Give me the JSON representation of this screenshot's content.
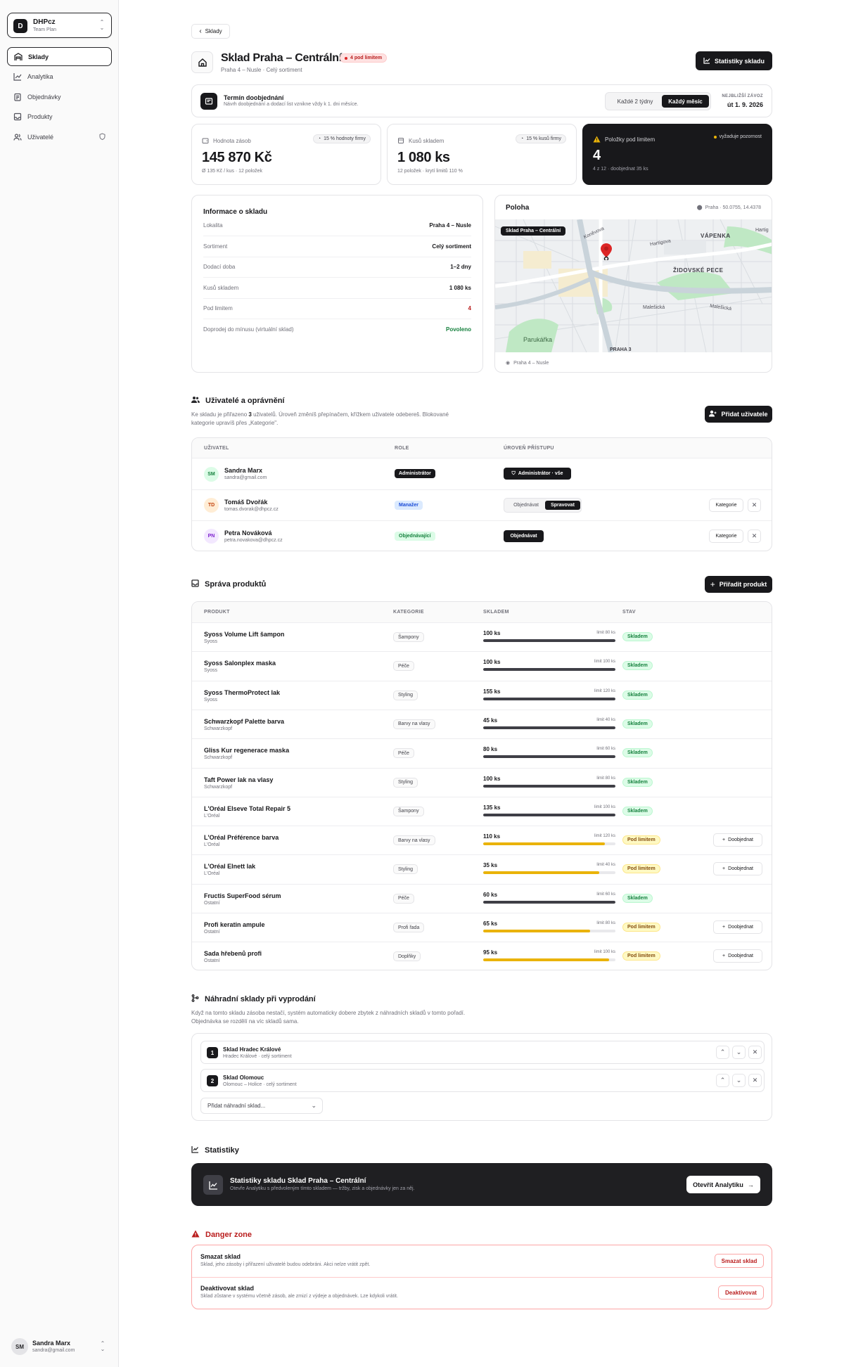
{
  "sidebar": {
    "team": {
      "initial": "D",
      "name": "DHPcz",
      "plan": "Team Plan"
    },
    "items": [
      {
        "label": "Sklady",
        "icon": "warehouse-icon",
        "active": true
      },
      {
        "label": "Analytika",
        "icon": "chart-line-icon"
      },
      {
        "label": "Objednávky",
        "icon": "clipboard-icon"
      },
      {
        "label": "Produkty",
        "icon": "inbox-icon"
      },
      {
        "label": "Uživatelé",
        "icon": "users-icon"
      }
    ],
    "user": {
      "initials": "SM",
      "name": "Sandra Marx",
      "email": "sandra@gmail.com"
    }
  },
  "header": {
    "back_label": "Sklady",
    "title": "Sklad Praha – Centrální",
    "badge": "4 pod limitem",
    "subtitle": "Praha 4 – Nusle · Celý sortiment",
    "stats_button": "Statistiky skladu"
  },
  "reorder": {
    "title": "Termín doobjednání",
    "desc": "Návrh doobjednání a dodací list vznikne vždy k 1. dni měsíce.",
    "options": [
      "Každé 2 týdny",
      "Každý měsíc"
    ],
    "next_label": "NEJBLIŽŠÍ ZÁVOZ",
    "next_value": "út 1. 9. 2026"
  },
  "kpis": [
    {
      "label": "Hodnota zásob",
      "badge": "15 % hodnoty firmy",
      "value": "145 870 Kč",
      "sub": "Ø 135 Kč / kus · 12 položek"
    },
    {
      "label": "Kusů skladem",
      "badge": "15 % kusů firmy",
      "value": "1 080 ks",
      "sub": "12 položek · krytí limitů 110 %"
    },
    {
      "label": "Položky pod limitem",
      "badge": "vyžaduje pozornost",
      "value": "4",
      "sub": "4 z 12 · doobjednat 35 ks"
    }
  ],
  "info": {
    "title": "Informace o skladu",
    "rows": [
      {
        "k": "Lokalita",
        "v": "Praha 4 – Nusle"
      },
      {
        "k": "Sortiment",
        "v": "Celý sortiment"
      },
      {
        "k": "Dodací doba",
        "v": "1–2 dny"
      },
      {
        "k": "Kusů skladem",
        "v": "1 080 ks"
      },
      {
        "k": "Pod limitem",
        "v": "4"
      },
      {
        "k": "Doprodej do mínusu (virtuální sklad)",
        "v": "Povoleno"
      }
    ]
  },
  "map": {
    "title": "Poloha",
    "coords": "Praha · 50.0755, 14.4378",
    "pin_label": "Sklad Praha – Centrální",
    "footer": "Praha 4 – Nusle",
    "labels": [
      "VÁPENKA",
      "ŽIDOVSKÉ PECE",
      "Hartigova",
      "Koněvova",
      "Malešická",
      "Malešická",
      "Parukářka",
      "PRAHA 3",
      "Hartig"
    ]
  },
  "users": {
    "title": "Uživatelé a oprávnění",
    "desc_a": "Ke skladu je přiřazeno ",
    "count": "3",
    "desc_b": " uživatelů. Úroveň změníš přepínačem, křížkem uživatele odebereš. Blokované kategorie upravíš přes „Kategorie\".",
    "add_button": "Přidat uživatele",
    "headers": [
      "UŽIVATEL",
      "ROLE",
      "ÚROVEŇ PŘÍSTUPU"
    ],
    "rows": [
      {
        "initials": "SM",
        "name": "Sandra Marx",
        "email": "sandra@gmail.com",
        "role": "Administrátor",
        "access": "Administrátor · vše"
      },
      {
        "initials": "TD",
        "name": "Tomáš Dvořák",
        "email": "tomas.dvorak@dhpcz.cz",
        "role": "Manažer",
        "access_options": [
          "Objednávat",
          "Spravovat"
        ],
        "cat": "Kategorie"
      },
      {
        "initials": "PN",
        "name": "Petra Nováková",
        "email": "petra.novakova@dhpcz.cz",
        "role": "Objednávající",
        "access_options": [
          "Objednávat"
        ],
        "cat": "Kategorie"
      }
    ]
  },
  "products": {
    "title": "Správa produktů",
    "add_button": "Přiřadit produkt",
    "headers": [
      "PRODUKT",
      "KATEGORIE",
      "SKLADEM",
      "STAV"
    ],
    "reorder_label": "Doobjednat",
    "rows": [
      {
        "name": "Syoss Volume Lift šampon",
        "brand": "Syoss",
        "cat": "Šampony",
        "stock": "100 ks",
        "limit": "limit 80 ks",
        "fill": 1.0,
        "status": "Skladem"
      },
      {
        "name": "Syoss Salonplex maska",
        "brand": "Syoss",
        "cat": "Péče",
        "stock": "100 ks",
        "limit": "limit 100 ks",
        "fill": 1.0,
        "status": "Skladem"
      },
      {
        "name": "Syoss ThermoProtect lak",
        "brand": "Syoss",
        "cat": "Styling",
        "stock": "155 ks",
        "limit": "limit 120 ks",
        "fill": 1.0,
        "status": "Skladem"
      },
      {
        "name": "Schwarzkopf Palette barva",
        "brand": "Schwarzkopf",
        "cat": "Barvy na vlasy",
        "stock": "45 ks",
        "limit": "limit 40 ks",
        "fill": 1.0,
        "status": "Skladem"
      },
      {
        "name": "Gliss Kur regenerace maska",
        "brand": "Schwarzkopf",
        "cat": "Péče",
        "stock": "80 ks",
        "limit": "limit 60 ks",
        "fill": 1.0,
        "status": "Skladem"
      },
      {
        "name": "Taft Power lak na vlasy",
        "brand": "Schwarzkopf",
        "cat": "Styling",
        "stock": "100 ks",
        "limit": "limit 80 ks",
        "fill": 1.0,
        "status": "Skladem"
      },
      {
        "name": "L'Oréal Elseve Total Repair 5",
        "brand": "L'Oréal",
        "cat": "Šampony",
        "stock": "135 ks",
        "limit": "limit 100 ks",
        "fill": 1.0,
        "status": "Skladem"
      },
      {
        "name": "L'Oréal Préférence barva",
        "brand": "L'Oréal",
        "cat": "Barvy na vlasy",
        "stock": "110 ks",
        "limit": "limit 120 ks",
        "fill": 0.92,
        "status": "Pod limitem"
      },
      {
        "name": "L'Oréal Elnett lak",
        "brand": "L'Oréal",
        "cat": "Styling",
        "stock": "35 ks",
        "limit": "limit 40 ks",
        "fill": 0.88,
        "status": "Pod limitem"
      },
      {
        "name": "Fructis SuperFood sérum",
        "brand": "Ostatní",
        "cat": "Péče",
        "stock": "60 ks",
        "limit": "limit 60 ks",
        "fill": 1.0,
        "status": "Skladem"
      },
      {
        "name": "Profi keratin ampule",
        "brand": "Ostatní",
        "cat": "Profi řada",
        "stock": "65 ks",
        "limit": "limit 80 ks",
        "fill": 0.81,
        "status": "Pod limitem"
      },
      {
        "name": "Sada hřebenů profi",
        "brand": "Ostatní",
        "cat": "Doplňky",
        "stock": "95 ks",
        "limit": "limit 100 ks",
        "fill": 0.95,
        "status": "Pod limitem"
      }
    ]
  },
  "fallback": {
    "title": "Náhradní sklady při vyprodání",
    "desc": "Když na tomto skladu zásoba nestačí, systém automaticky dobere zbytek z náhradních skladů v tomto pořadí. Objednávka se rozdělí na víc skladů sama.",
    "items": [
      {
        "n": "1",
        "name": "Sklad Hradec Králové",
        "sub": "Hradec Králové · celý sortiment"
      },
      {
        "n": "2",
        "name": "Sklad Olomouc",
        "sub": "Olomouc – Holice · celý sortiment"
      }
    ],
    "add_placeholder": "Přidat náhradní sklad..."
  },
  "stats": {
    "section_title": "Statistiky",
    "title": "Statistiky skladu Sklad Praha – Centrální",
    "desc": "Otevře Analytiku s předvoleným tímto skladem — tržby, zisk a objednávky jen za něj.",
    "button": "Otevřít Analytiku"
  },
  "danger": {
    "title": "Danger zone",
    "items": [
      {
        "title": "Smazat sklad",
        "desc": "Sklad, jeho zásoby i přiřazení uživatelé budou odebráni. Akci nelze vrátit zpět.",
        "button": "Smazat sklad"
      },
      {
        "title": "Deaktivovat sklad",
        "desc": "Sklad zůstane v systému včetně zásob, ale zmizí z výdeje a objednávek. Lze kdykoli vrátit.",
        "button": "Deaktivovat"
      }
    ]
  },
  "colors": {
    "accent": "#18181b",
    "danger": "#b91c1c",
    "ok": "#15803d",
    "warn": "#eab308"
  }
}
